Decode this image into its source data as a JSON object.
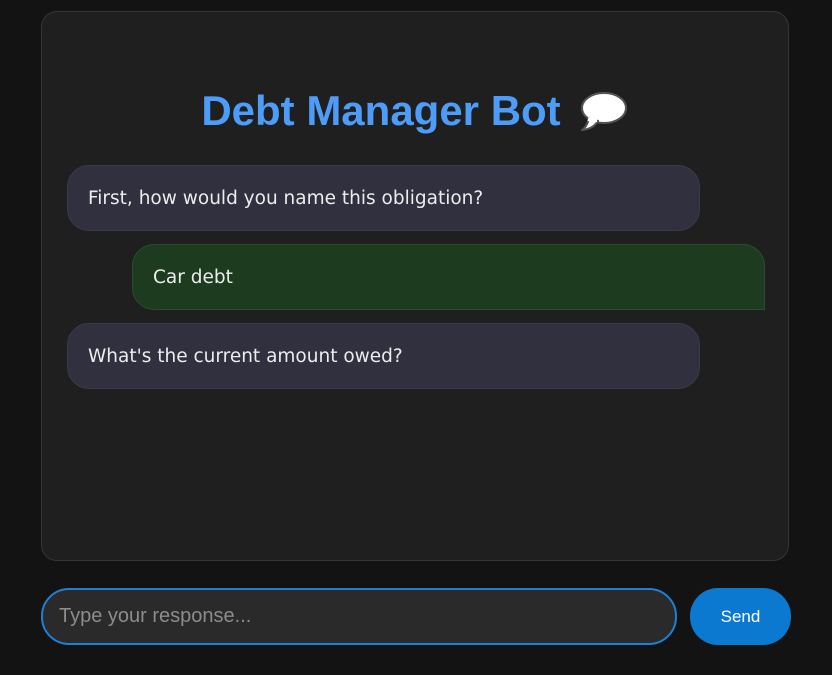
{
  "app": {
    "title": "Debt Manager Bot",
    "title_icon": "speech-bubble-icon"
  },
  "messages": [
    {
      "sender": "bot",
      "text": "First, how would you name this obligation?"
    },
    {
      "sender": "user",
      "text": "Car debt"
    },
    {
      "sender": "bot",
      "text": "What's the current amount owed?"
    }
  ],
  "composer": {
    "placeholder": "Type your response...",
    "value": "",
    "send_label": "Send"
  },
  "colors": {
    "accent": "#4c9cf8",
    "bot_bubble": "#30303f",
    "user_bubble": "#1d3b1e",
    "send_button": "#0b79d0"
  }
}
